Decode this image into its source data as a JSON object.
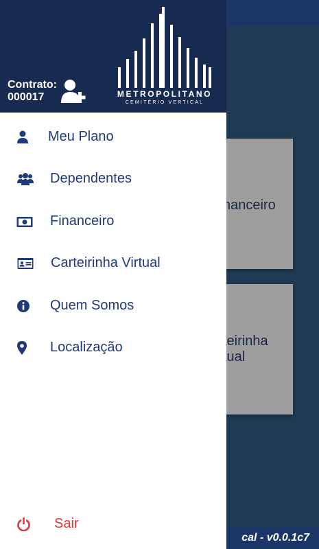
{
  "background": {
    "cards": [
      {
        "label_line1": "nanceiro",
        "label_line2": ""
      },
      {
        "label_line1": "teirinha",
        "label_line2": "tual"
      }
    ],
    "footer_version": "cal - v0.0.1c7"
  },
  "header": {
    "contract_label": "Contrato:",
    "contract_number": "000017",
    "logo_name": "METROPOLITANO",
    "logo_sub": "CEMITÉRIO VERTICAL"
  },
  "menu": [
    {
      "label": "Meu Plano",
      "icon": "user-icon"
    },
    {
      "label": "Dependentes",
      "icon": "users-icon"
    },
    {
      "label": "Financeiro",
      "icon": "money-icon"
    },
    {
      "label": "Carteirinha Virtual",
      "icon": "id-card-icon"
    },
    {
      "label": "Quem Somos",
      "icon": "info-icon"
    },
    {
      "label": "Localização",
      "icon": "map-pin-icon"
    }
  ],
  "logout": {
    "label": "Sair",
    "icon": "power-icon"
  },
  "colors": {
    "header": "#172a4f",
    "accent": "#1f3a7a",
    "logout": "#e0353b"
  }
}
